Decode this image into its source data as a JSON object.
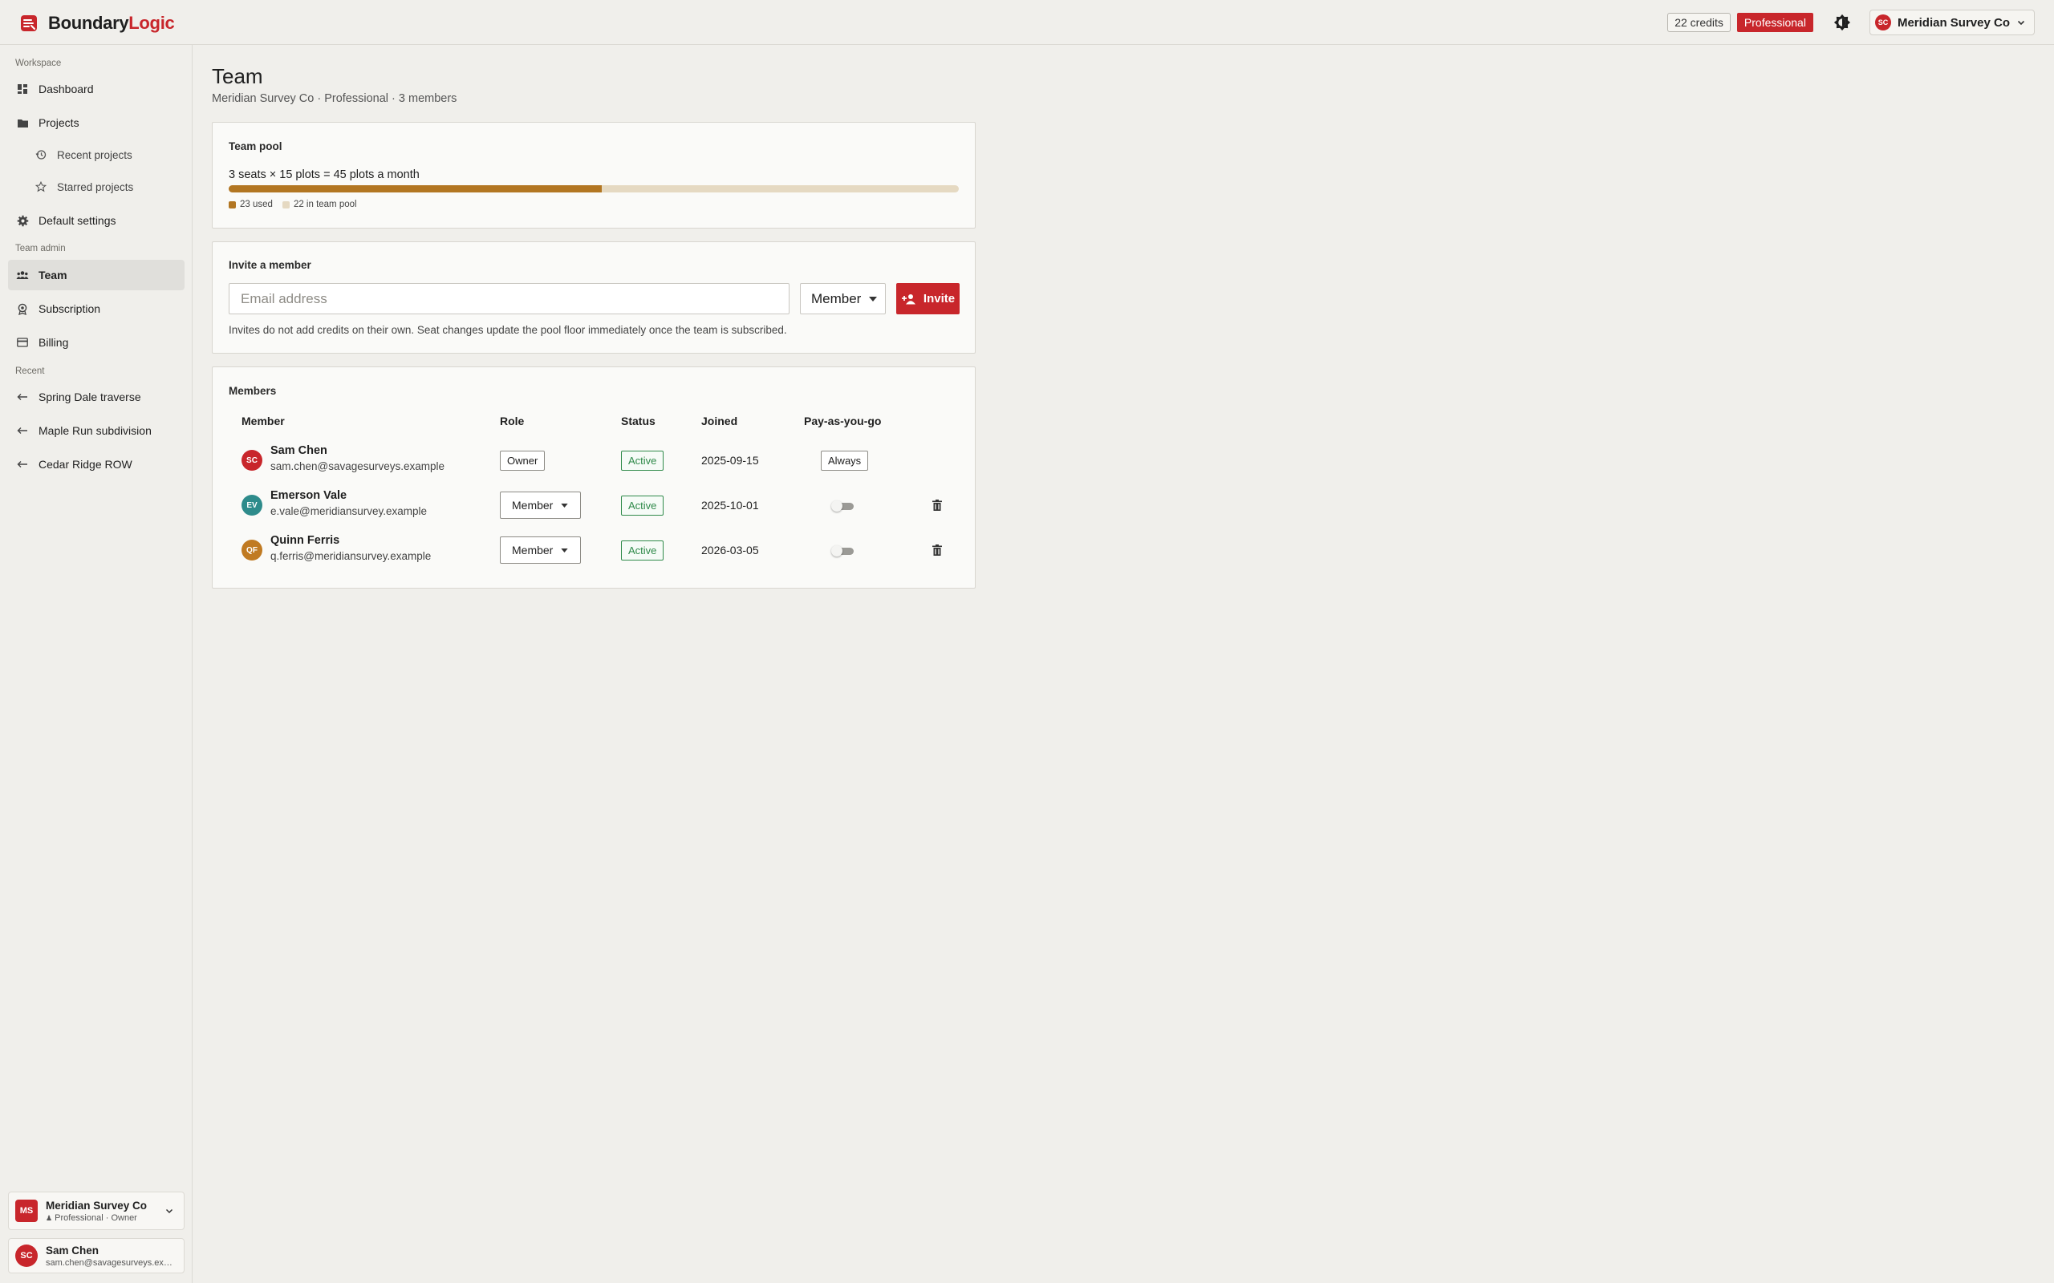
{
  "brand": {
    "name_part1": "Boundary",
    "name_part2": "Logic",
    "accent": "#c8262b"
  },
  "header": {
    "credits": "22 credits",
    "plan": "Professional",
    "theme_icon": "theme-toggle-icon",
    "org_initials": "SC",
    "org_name": "Meridian Survey Co"
  },
  "sidebar": {
    "workspace_label": "Workspace",
    "items": [
      {
        "label": "Dashboard",
        "icon": "dashboard-icon"
      },
      {
        "label": "Projects",
        "icon": "folder-icon"
      },
      {
        "label": "Recent projects",
        "icon": "history-icon"
      },
      {
        "label": "Starred projects",
        "icon": "star-icon"
      },
      {
        "label": "Default settings",
        "icon": "gear-icon"
      }
    ],
    "team_admin_label": "Team admin",
    "admin_items": [
      {
        "label": "Team",
        "icon": "team-icon"
      },
      {
        "label": "Subscription",
        "icon": "badge-icon"
      },
      {
        "label": "Billing",
        "icon": "card-icon"
      }
    ],
    "recent_label": "Recent",
    "recent_items": [
      {
        "label": "Spring Dale traverse",
        "icon": "return-icon"
      },
      {
        "label": "Maple Run subdivision",
        "icon": "return-icon"
      },
      {
        "label": "Cedar Ridge ROW",
        "icon": "return-icon"
      }
    ],
    "org_card": {
      "initials": "MS",
      "name": "Meridian Survey Co",
      "sub": "Professional · Owner"
    },
    "user_card": {
      "initials": "SC",
      "name": "Sam Chen",
      "email": "sam.chen@savagesurveys.example"
    }
  },
  "page": {
    "title": "Team",
    "subtitle": "Meridian Survey Co · Professional · 3 members"
  },
  "pool": {
    "title": "Team pool",
    "description": "3 seats × 15 plots = 45 plots a month",
    "used": 23,
    "total": 45,
    "used_fraction": 0.511,
    "used_label": "23 used",
    "remaining_label": "22 in team pool",
    "used_color": "#b27622",
    "remaining_color": "#e5d9c2"
  },
  "invite": {
    "title": "Invite a member",
    "email_placeholder": "Email address",
    "role_value": "Member",
    "button_label": "Invite",
    "note": "Invites do not add credits on their own. Seat changes update the pool floor immediately once the team is subscribed."
  },
  "members": {
    "title": "Members",
    "columns": [
      "Member",
      "Role",
      "Status",
      "Joined",
      "Pay-as-you-go"
    ],
    "rows": [
      {
        "initials": "SC",
        "avatar_color": "#c8262b",
        "name": "Sam Chen",
        "email": "sam.chen@savagesurveys.example",
        "role": "Owner",
        "status": "Active",
        "joined": "2025-09-15",
        "payg": "Always"
      },
      {
        "initials": "EV",
        "avatar_color": "#2e8b8b",
        "name": "Emerson Vale",
        "email": "e.vale@meridiansurvey.example",
        "role": "Member",
        "status": "Active",
        "joined": "2025-10-01",
        "payg_enabled": false
      },
      {
        "initials": "QF",
        "avatar_color": "#c07a22",
        "name": "Quinn Ferris",
        "email": "q.ferris@meridiansurvey.example",
        "role": "Member",
        "status": "Active",
        "joined": "2026-03-05",
        "payg_enabled": false
      }
    ]
  }
}
